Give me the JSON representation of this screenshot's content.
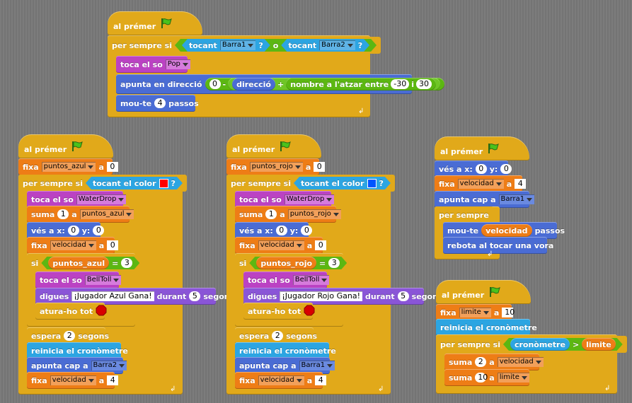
{
  "colors": {
    "control": "#e1a91a",
    "looks": "#8a55d7",
    "sound": "#bb42c3",
    "motion": "#4a6cd4",
    "variables": "#ee7d16",
    "sensing": "#2ca5e2",
    "operators": "#5cb712",
    "red": "#ff0000",
    "blue": "#0055ff"
  },
  "common": {
    "when_flag": "al prémer",
    "forever": "per sempre",
    "forever_if": "per sempre si",
    "if": "si",
    "or": "o",
    "touching": "tocant",
    "touching_color": "tocant el color",
    "play_sound": "toca el so",
    "set": "fixa",
    "to": "a",
    "change": "suma",
    "goto_x": "vés a x:",
    "y": "y:",
    "say": "digues",
    "for": "durant",
    "secs": "segons",
    "stop_all": "atura-ho tot",
    "wait": "espera",
    "reset_timer": "reinicia el cronòmetre",
    "point_towards": "apunta cap a",
    "point_in_dir": "apunta en direcció",
    "direction": "direcció",
    "pick_random": "nombre a l'atzar entre",
    "and_i": "i",
    "move": "mou-te",
    "steps": "passos",
    "bounce": "rebota al tocar una vora",
    "timer": "cronòmetre",
    "q": "?"
  },
  "s1": {
    "sprite1": "Barra1",
    "sprite2": "Barra2",
    "sound": "Pop",
    "dir_a": "0",
    "dir_minus": "-",
    "dir_plus": "+",
    "rand_min": "-30",
    "rand_max": "30",
    "move_steps": "4"
  },
  "s2": {
    "var_pts": "puntos_azul",
    "set_pts": "0",
    "sound1": "WaterDrop",
    "change_by": "1",
    "x": "0",
    "y": "0",
    "var_vel": "velocidad",
    "set_vel": "0",
    "if_var": "puntos_azul",
    "eq": "=",
    "if_val": "3",
    "sound2": "BellToll",
    "say_text": "¡Jugador Azul Gana!",
    "say_secs": "5",
    "wait_secs": "2",
    "point_to": "Barra2",
    "final_vel": "4"
  },
  "s3": {
    "var_pts": "puntos_rojo",
    "set_pts": "0",
    "sound1": "WaterDrop",
    "change_by": "1",
    "x": "0",
    "y": "0",
    "var_vel": "velocidad",
    "set_vel": "0",
    "if_var": "puntos_rojo",
    "eq": "=",
    "if_val": "3",
    "sound2": "BellToll",
    "say_text": "¡Jugador Rojo Gana!",
    "say_secs": "5",
    "wait_secs": "2",
    "point_to": "Barra1",
    "final_vel": "4"
  },
  "s4": {
    "x": "0",
    "y": "0",
    "var_vel": "velocidad",
    "set_vel": "4",
    "point_to": "Barra1",
    "move_var": "velocidad"
  },
  "s5": {
    "var_lim": "limite",
    "set_lim": "10",
    "gt": ">",
    "lim_reporter": "limite",
    "ch1_by": "2",
    "ch1_var": "velocidad",
    "ch2_by": "10",
    "ch2_var": "limite"
  }
}
